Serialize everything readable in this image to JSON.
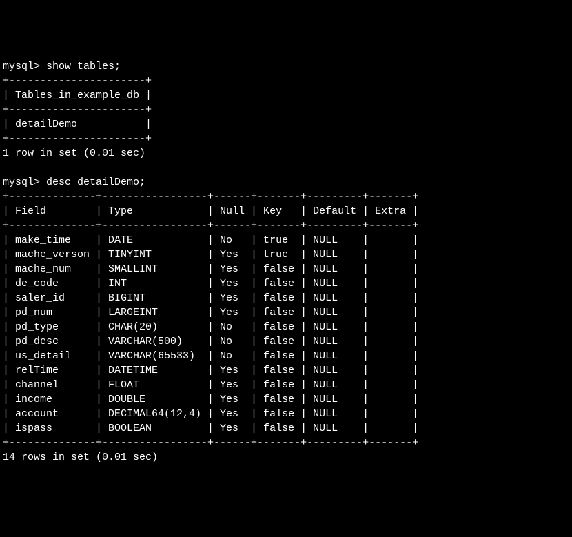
{
  "prompt": "mysql>",
  "cmd1": "show tables;",
  "cmd2": "desc detailDemo;",
  "tables_header": "Tables_in_example_db",
  "tables_row": "detailDemo",
  "tables_footer": "1 row in set (0.01 sec)",
  "desc_headers": [
    "Field",
    "Type",
    "Null",
    "Key",
    "Default",
    "Extra"
  ],
  "desc_rows": [
    {
      "field": "make_time",
      "type": "DATE",
      "null": "No",
      "key": "true",
      "default": "NULL",
      "extra": ""
    },
    {
      "field": "mache_verson",
      "type": "TINYINT",
      "null": "Yes",
      "key": "true",
      "default": "NULL",
      "extra": ""
    },
    {
      "field": "mache_num",
      "type": "SMALLINT",
      "null": "Yes",
      "key": "false",
      "default": "NULL",
      "extra": ""
    },
    {
      "field": "de_code",
      "type": "INT",
      "null": "Yes",
      "key": "false",
      "default": "NULL",
      "extra": ""
    },
    {
      "field": "saler_id",
      "type": "BIGINT",
      "null": "Yes",
      "key": "false",
      "default": "NULL",
      "extra": ""
    },
    {
      "field": "pd_num",
      "type": "LARGEINT",
      "null": "Yes",
      "key": "false",
      "default": "NULL",
      "extra": ""
    },
    {
      "field": "pd_type",
      "type": "CHAR(20)",
      "null": "No",
      "key": "false",
      "default": "NULL",
      "extra": ""
    },
    {
      "field": "pd_desc",
      "type": "VARCHAR(500)",
      "null": "No",
      "key": "false",
      "default": "NULL",
      "extra": ""
    },
    {
      "field": "us_detail",
      "type": "VARCHAR(65533)",
      "null": "No",
      "key": "false",
      "default": "NULL",
      "extra": ""
    },
    {
      "field": "relTime",
      "type": "DATETIME",
      "null": "Yes",
      "key": "false",
      "default": "NULL",
      "extra": ""
    },
    {
      "field": "channel",
      "type": "FLOAT",
      "null": "Yes",
      "key": "false",
      "default": "NULL",
      "extra": ""
    },
    {
      "field": "income",
      "type": "DOUBLE",
      "null": "Yes",
      "key": "false",
      "default": "NULL",
      "extra": ""
    },
    {
      "field": "account",
      "type": "DECIMAL64(12,4)",
      "null": "Yes",
      "key": "false",
      "default": "NULL",
      "extra": ""
    },
    {
      "field": "ispass",
      "type": "BOOLEAN",
      "null": "Yes",
      "key": "false",
      "default": "NULL",
      "extra": ""
    }
  ],
  "desc_footer": "14 rows in set (0.01 sec)",
  "chart_data": {
    "type": "table",
    "title": "desc detailDemo",
    "columns": [
      "Field",
      "Type",
      "Null",
      "Key",
      "Default",
      "Extra"
    ],
    "rows": [
      [
        "make_time",
        "DATE",
        "No",
        "true",
        "NULL",
        ""
      ],
      [
        "mache_verson",
        "TINYINT",
        "Yes",
        "true",
        "NULL",
        ""
      ],
      [
        "mache_num",
        "SMALLINT",
        "Yes",
        "false",
        "NULL",
        ""
      ],
      [
        "de_code",
        "INT",
        "Yes",
        "false",
        "NULL",
        ""
      ],
      [
        "saler_id",
        "BIGINT",
        "Yes",
        "false",
        "NULL",
        ""
      ],
      [
        "pd_num",
        "LARGEINT",
        "Yes",
        "false",
        "NULL",
        ""
      ],
      [
        "pd_type",
        "CHAR(20)",
        "No",
        "false",
        "NULL",
        ""
      ],
      [
        "pd_desc",
        "VARCHAR(500)",
        "No",
        "false",
        "NULL",
        ""
      ],
      [
        "us_detail",
        "VARCHAR(65533)",
        "No",
        "false",
        "NULL",
        ""
      ],
      [
        "relTime",
        "DATETIME",
        "Yes",
        "false",
        "NULL",
        ""
      ],
      [
        "channel",
        "FLOAT",
        "Yes",
        "false",
        "NULL",
        ""
      ],
      [
        "income",
        "DOUBLE",
        "Yes",
        "false",
        "NULL",
        ""
      ],
      [
        "account",
        "DECIMAL64(12,4)",
        "Yes",
        "false",
        "NULL",
        ""
      ],
      [
        "ispass",
        "BOOLEAN",
        "Yes",
        "false",
        "NULL",
        ""
      ]
    ]
  }
}
